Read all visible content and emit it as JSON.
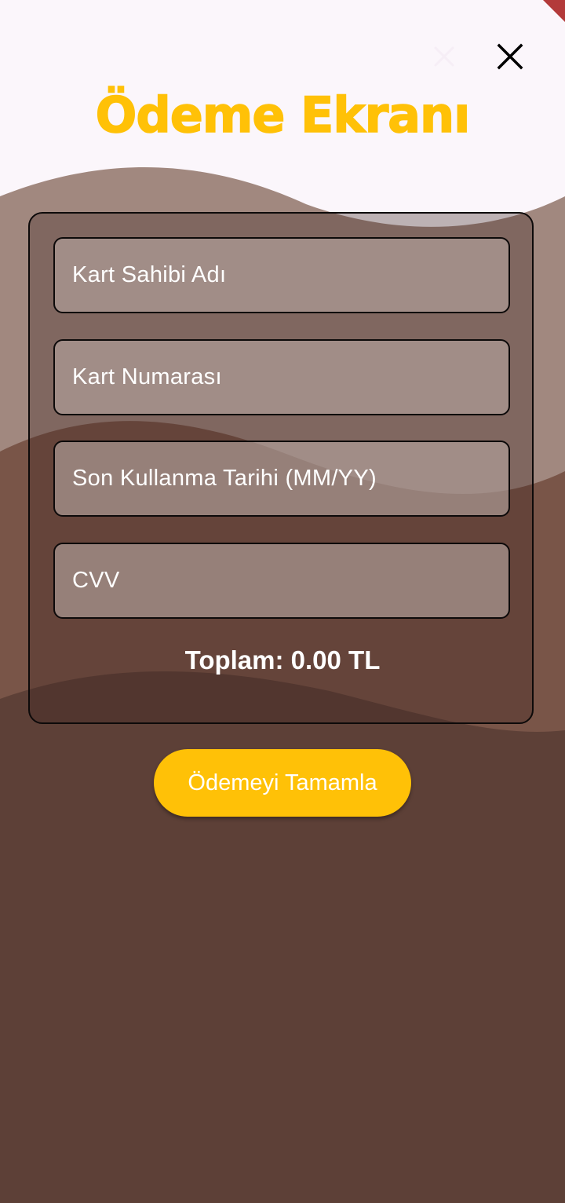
{
  "header": {
    "title": "Ödeme Ekranı",
    "close_icon": "close-icon"
  },
  "form": {
    "cardholder_placeholder": "Kart Sahibi Adı",
    "card_number_placeholder": "Kart Numarası",
    "expiry_placeholder": "Son Kullanma Tarihi (MM/YY)",
    "cvv_placeholder": "CVV"
  },
  "summary": {
    "total": "Toplam: 0.00 TL"
  },
  "actions": {
    "submit_label": "Ödemeyi Tamamla"
  },
  "colors": {
    "accent": "#FFC107",
    "background_top": "#FBF6FB",
    "wave_light": "#A1887F",
    "wave_mid": "#795548",
    "wave_dark": "#5D4037"
  }
}
